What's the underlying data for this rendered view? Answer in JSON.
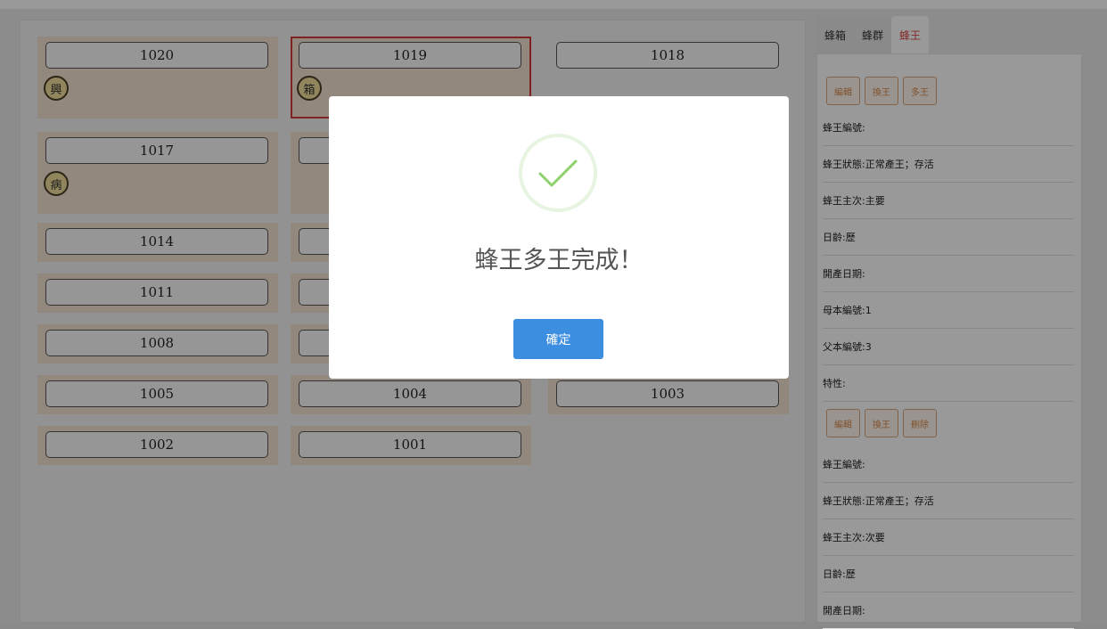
{
  "hive_grid": {
    "cells": [
      {
        "number": "1020",
        "badge": "興"
      },
      {
        "number": "1019",
        "badge": "箱"
      },
      {
        "number": "1018",
        "badge": ""
      },
      {
        "number": "1017",
        "badge": "病"
      },
      {
        "number": "",
        "badge": ""
      },
      {
        "number": "1014",
        "badge": ""
      },
      {
        "number": "",
        "badge": ""
      },
      {
        "number": "1011",
        "badge": ""
      },
      {
        "number": "",
        "badge": ""
      },
      {
        "number": "1008",
        "badge": ""
      },
      {
        "number": "",
        "badge": ""
      },
      {
        "number": "1005",
        "badge": ""
      },
      {
        "number": "1004",
        "badge": ""
      },
      {
        "number": "1003",
        "badge": ""
      },
      {
        "number": "1002",
        "badge": ""
      },
      {
        "number": "1001",
        "badge": ""
      }
    ],
    "selected_number": "1019"
  },
  "right_panel": {
    "tabs": [
      "蜂箱",
      "蜂群",
      "蜂王"
    ],
    "active_tab": "蜂王",
    "queen_1": {
      "buttons": [
        "編輯",
        "換王",
        "多王"
      ],
      "fields": [
        "蜂王編號:",
        "蜂王狀態:正常產王；存活",
        "蜂王主次:主要",
        "日齡:歷",
        "開產日期:",
        "母本編號:1",
        "父本編號:3",
        "特性:"
      ]
    },
    "queen_2": {
      "buttons": [
        "編輯",
        "換王",
        "刪除"
      ],
      "fields": [
        "蜂王編號:",
        "蜂王狀態:正常產王；存活",
        "蜂王主次:次要",
        "日齡:歷",
        "開產日期:"
      ]
    }
  },
  "dialog": {
    "icon": "checkmark-icon",
    "message": "蜂王多王完成！",
    "confirm_label": "確定"
  },
  "colors": {
    "accent": "#3c8ee0",
    "success": "#8cd16a",
    "selected_border": "#d83a3a",
    "action_text": "#d98a4a"
  }
}
